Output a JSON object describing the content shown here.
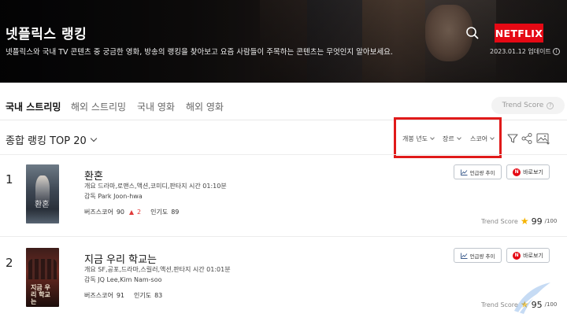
{
  "header": {
    "title": "넷플릭스 랭킹",
    "description": "넷플릭스와 국내 TV 콘텐츠 중 궁금한 영화, 방송의 랭킹을 찾아보고 요즘 사람들이 주목하는 콘텐츠는 무엇인지 알아보세요.",
    "logo": "NETFLIX",
    "update_text": "2023.01.12 업데이트",
    "search_icon": "search-icon",
    "colors": {
      "brand": "#e50914"
    }
  },
  "tabs": [
    {
      "label": "국내 스트리밍",
      "active": true
    },
    {
      "label": "해외 스트리밍",
      "active": false
    },
    {
      "label": "국내 영화",
      "active": false
    },
    {
      "label": "해외 영화",
      "active": false
    }
  ],
  "trend_toggle": {
    "label": "Trend Score"
  },
  "ranking": {
    "title": "종합 랭킹 TOP 20",
    "filters": [
      "개봉 년도",
      "장르",
      "스코어"
    ],
    "highlight_color": "#e01a1a"
  },
  "items": [
    {
      "rank": "1",
      "title": "환혼",
      "genre": "개요 드라마,로맨스,액션,코미디,판타지   시간 01:10분",
      "director": "감독 Park Joon-hwa",
      "buzz_label": "버즈스코어",
      "buzz_value": "90",
      "buzz_change": "2",
      "popularity_label": "인기도",
      "popularity_value": "89",
      "trend_button": "언급량 추이",
      "watch_button": "바로보기",
      "trend_score_label": "Trend Score",
      "trend_score_value": "99",
      "trend_score_max": "/100",
      "poster_text": "환혼"
    },
    {
      "rank": "2",
      "title": "지금 우리 학교는",
      "genre": "개요 SF,공포,드라마,스릴러,액션,판타지   시간 01:01분",
      "director": "감독 JQ Lee,Kim Nam-soo",
      "buzz_label": "버즈스코어",
      "buzz_value": "91",
      "popularity_label": "인기도",
      "popularity_value": "83",
      "trend_button": "언급량 추이",
      "watch_button": "바로보기",
      "trend_score_label": "Trend Score",
      "trend_score_value": "95",
      "trend_score_max": "/100",
      "poster_text": "지금 우리 학교는"
    }
  ]
}
